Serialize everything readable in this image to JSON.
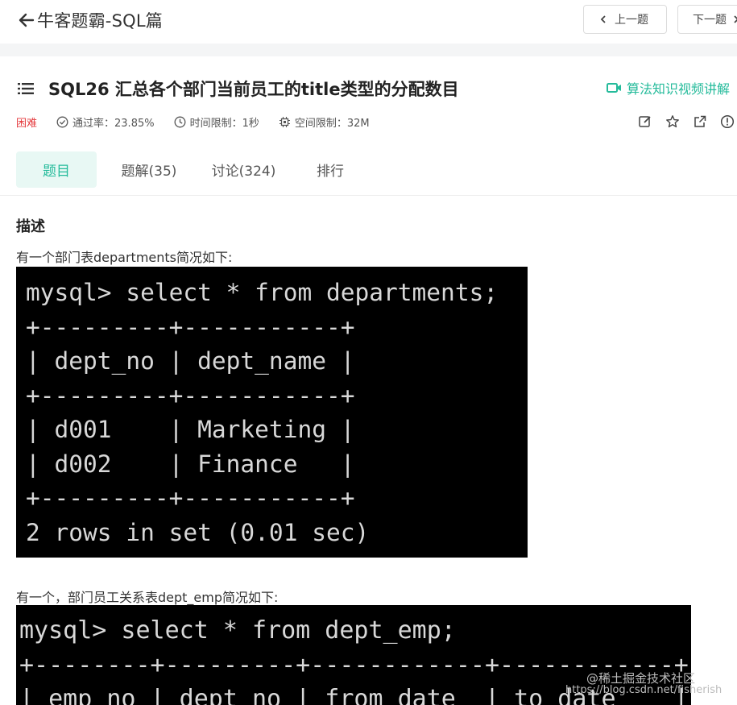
{
  "header": {
    "back_title": "牛客题霸-SQL篇",
    "prev_label": "上一题",
    "next_label": "下一题"
  },
  "question": {
    "title": "SQL26  汇总各个部门当前员工的title类型的分配数目",
    "video_link": "算法知识视频讲解",
    "difficulty": "困难",
    "pass_rate": "通过率：23.85%",
    "time_limit": "时间限制：1秒",
    "space_limit": "空间限制：32M"
  },
  "tabs": [
    {
      "label": "题目",
      "active": true
    },
    {
      "label": "题解(35)",
      "active": false
    },
    {
      "label": "讨论(324)",
      "active": false
    },
    {
      "label": "排行",
      "active": false
    }
  ],
  "content": {
    "section_title": "描述",
    "para1": "有一个部门表departments简况如下:",
    "terminal1": [
      "mysql> select * from departments;",
      "+---------+-----------+",
      "| dept_no | dept_name |",
      "+---------+-----------+",
      "| d001    | Marketing |",
      "| d002    | Finance   |",
      "+---------+-----------+",
      "2 rows in set (0.01 sec)"
    ],
    "para2": "有一个，部门员工关系表dept_emp简况如下:",
    "terminal2": [
      "mysql> select * from dept_emp;",
      "+--------+---------+------------+------------+",
      "| emp_no | dept_no | from_date  | to_date    |"
    ]
  },
  "watermark": {
    "line1": "@稀土掘金技术社区",
    "line2": "https://blog.csdn.net/fisherish"
  },
  "colors": {
    "accent": "#25bb9b",
    "difficulty": "#e4393c",
    "terminal_bg": "#000000"
  }
}
